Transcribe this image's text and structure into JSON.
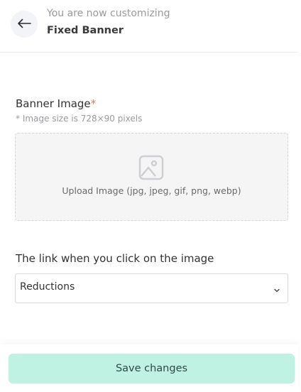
{
  "header": {
    "subtitle": "You are now customizing",
    "title": "Fixed Banner",
    "back_icon": "arrow-left-icon"
  },
  "banner_image": {
    "label": "Banner Image",
    "required_marker": "*",
    "hint": "* Image size is 728×90 pixels",
    "upload_icon": "image-icon",
    "upload_text": "Upload Image (jpg, jpeg, gif, png, webp)"
  },
  "link": {
    "label": "The link when you click on the image",
    "selected": "Reductions",
    "chevron_icon": "chevron-down-icon"
  },
  "footer": {
    "save_label": "Save changes"
  },
  "colors": {
    "save_button_bg": "#bff2e3",
    "required_marker": "#e07a5f"
  }
}
